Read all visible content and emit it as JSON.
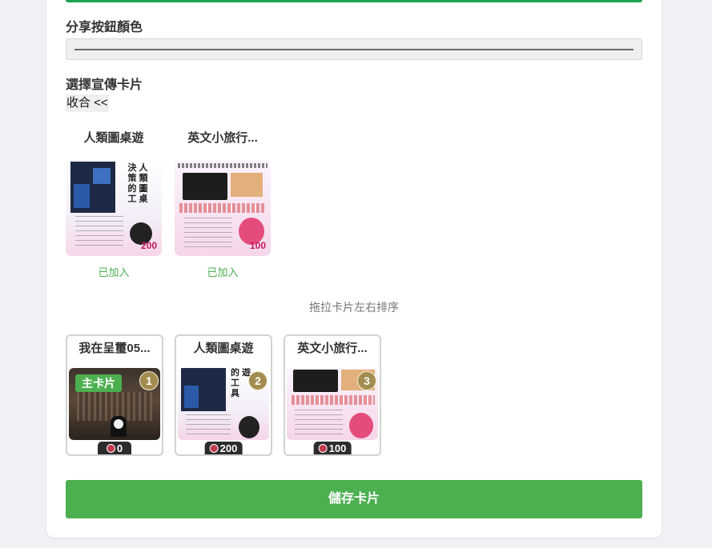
{
  "share_button_color": {
    "label": "分享按鈕顏色"
  },
  "card_select": {
    "label": "選擇宣傳卡片",
    "collapse_label": "收合 <<",
    "available": [
      {
        "title": "人類圖桌遊",
        "status": "已加入",
        "points": "200"
      },
      {
        "title": "英文小旅行...",
        "status": "已加入",
        "points": "100"
      }
    ],
    "hint": "拖拉卡片左右排序",
    "selected": [
      {
        "title": "我在呈璽05...",
        "order": "1",
        "main_badge": "主卡片",
        "points": "0"
      },
      {
        "title": "人類圖桌遊",
        "order": "2",
        "points": "200"
      },
      {
        "title": "英文小旅行...",
        "order": "3",
        "points": "100"
      }
    ]
  },
  "save_button": {
    "label": "儲存卡片"
  },
  "colors": {
    "accent_green": "#4caf50",
    "top_bar_green": "#1aa350",
    "badge_gold": "#a38c4f"
  }
}
